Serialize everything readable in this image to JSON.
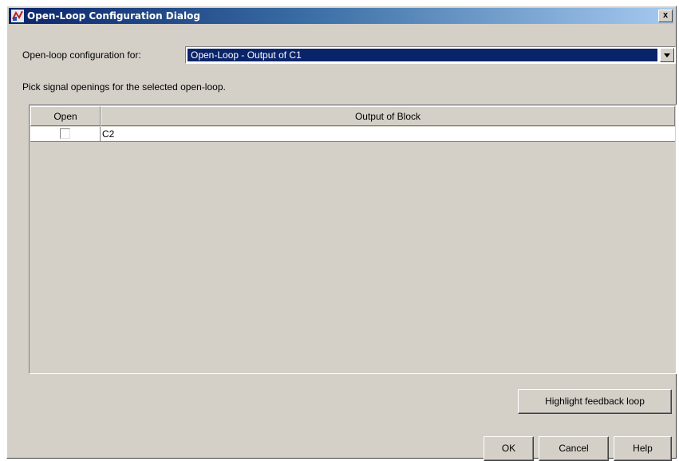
{
  "window": {
    "title": "Open-Loop Configuration Dialog",
    "close_label": "x"
  },
  "config": {
    "label": "Open-loop configuration for:",
    "selected_value": "Open-Loop - Output of C1"
  },
  "hint": "Pick signal openings for the selected open-loop.",
  "table": {
    "columns": [
      "Open",
      "Output of Block"
    ],
    "rows": [
      {
        "open": false,
        "output": "C2"
      }
    ]
  },
  "buttons": {
    "highlight": "Highlight feedback loop",
    "ok": "OK",
    "cancel": "Cancel",
    "help": "Help"
  },
  "colors": {
    "dialog_bg": "#d4d0c8",
    "title_start": "#0a246a",
    "selection": "#0a246a"
  }
}
